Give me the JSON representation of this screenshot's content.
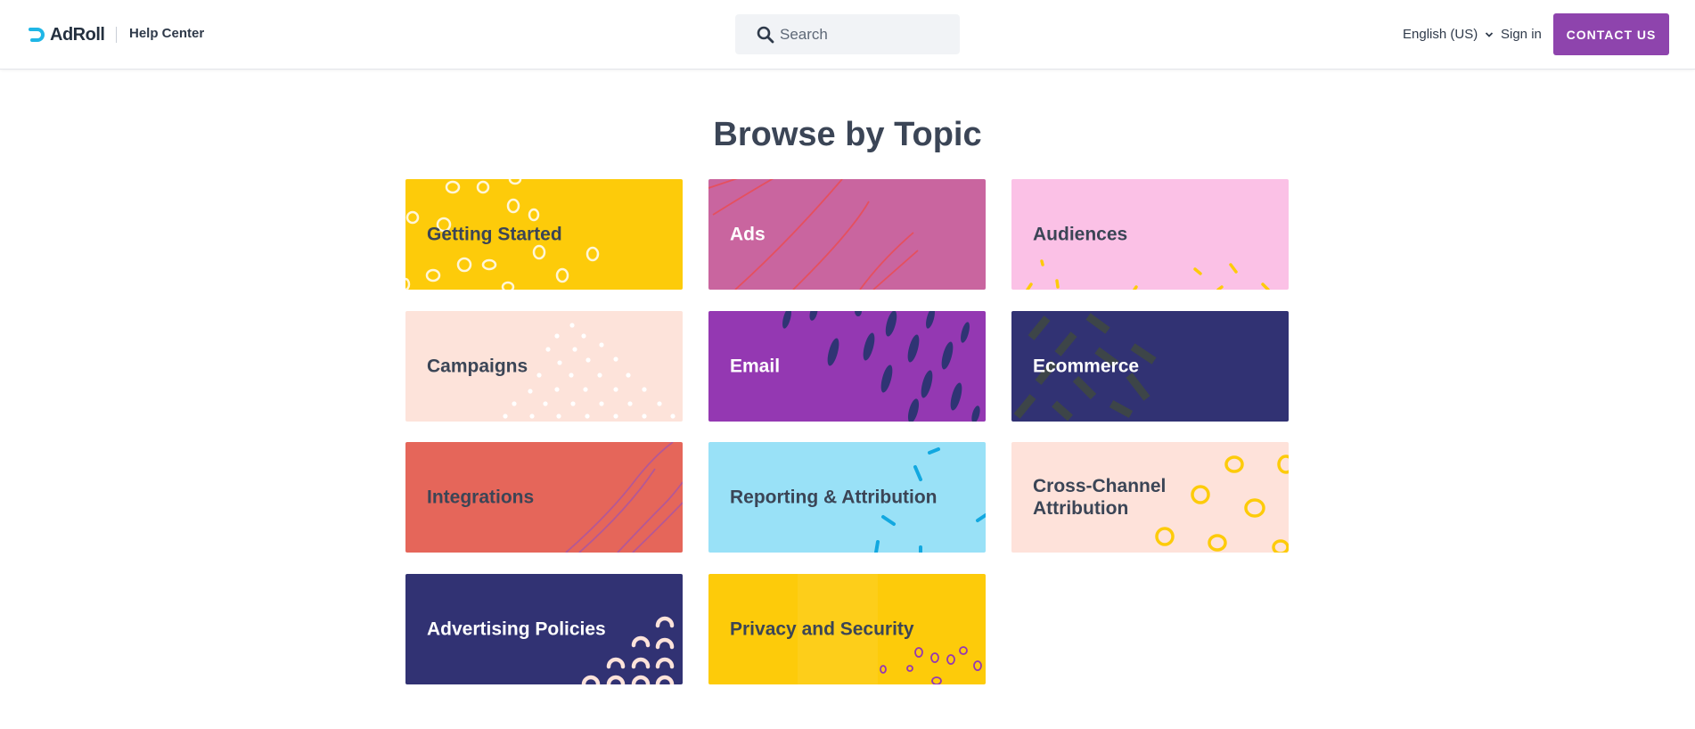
{
  "header": {
    "logo_text": "AdRoll",
    "help_center": "Help Center",
    "search_placeholder": "Search",
    "language": "English (US)",
    "sign_in": "Sign in",
    "contact_button": "CONTACT US"
  },
  "main": {
    "title": "Browse by Topic",
    "topics": [
      {
        "label": "Getting Started",
        "color": "#fdcb0a"
      },
      {
        "label": "Ads",
        "color": "#c9659f"
      },
      {
        "label": "Audiences",
        "color": "#fbc1e6"
      },
      {
        "label": "Campaigns",
        "color": "#fde3da"
      },
      {
        "label": "Email",
        "color": "#9438b2"
      },
      {
        "label": "Ecommerce",
        "color": "#313273"
      },
      {
        "label": "Integrations",
        "color": "#e5665a"
      },
      {
        "label": "Reporting & Attribution",
        "color": "#99e1f7"
      },
      {
        "label": "Cross-Channel Attribution",
        "color": "#fee2da"
      },
      {
        "label": "Advertising Policies",
        "color": "#313273"
      },
      {
        "label": "Privacy and Security",
        "color": "#fdcb0a"
      }
    ]
  },
  "colors": {
    "brand_purple": "#8e44ad",
    "logo_blue": "#1fb6e6"
  }
}
